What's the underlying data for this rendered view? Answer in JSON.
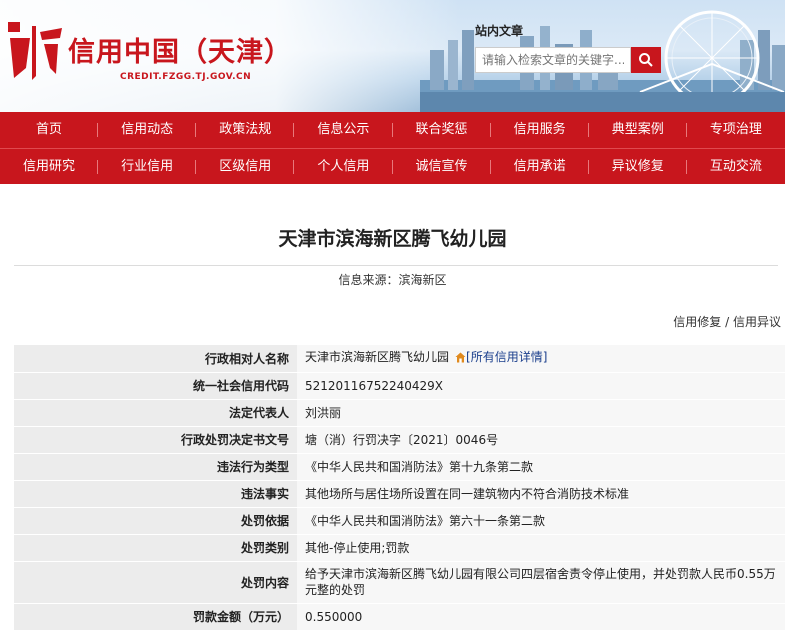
{
  "header": {
    "site_title": "信用中国（天津）",
    "site_domain": "CREDIT.FZGG.TJ.GOV.CN",
    "search_title": "站内文章",
    "search_placeholder": "请输入检索文章的关键字..."
  },
  "nav": {
    "row1": [
      "首页",
      "信用动态",
      "政策法规",
      "信息公示",
      "联合奖惩",
      "信用服务",
      "典型案例",
      "专项治理"
    ],
    "row2": [
      "信用研究",
      "行业信用",
      "区级信用",
      "个人信用",
      "诚信宣传",
      "信用承诺",
      "异议修复",
      "互动交流"
    ]
  },
  "page": {
    "title": "天津市滨海新区腾飞幼儿园",
    "source": "信息来源：滨海新区",
    "link_repair": "信用修复",
    "link_sep": " / ",
    "link_objection": "信用异议",
    "detail_link": "[所有信用详情]"
  },
  "rows": [
    {
      "label": "行政相对人名称",
      "value": "天津市滨海新区腾飞幼儿园"
    },
    {
      "label": "统一社会信用代码",
      "value": "52120116752240429X"
    },
    {
      "label": "法定代表人",
      "value": "刘洪丽"
    },
    {
      "label": "行政处罚决定书文号",
      "value": "塘（消）行罚决字〔2021〕0046号"
    },
    {
      "label": "违法行为类型",
      "value": "《中华人民共和国消防法》第十九条第二款"
    },
    {
      "label": "违法事实",
      "value": "其他场所与居住场所设置在同一建筑物内不符合消防技术标准"
    },
    {
      "label": "处罚依据",
      "value": "《中华人民共和国消防法》第六十一条第二款"
    },
    {
      "label": "处罚类别",
      "value": "其他-停止使用;罚款"
    },
    {
      "label": "处罚内容",
      "value": "给予天津市滨海新区腾飞幼儿园有限公司四层宿舍责令停止使用，并处罚款人民币0.55万元整的处罚"
    },
    {
      "label": "罚款金额（万元）",
      "value": "0.550000"
    }
  ],
  "colors": {
    "brand_red": "#c8161d",
    "link_blue": "#1a3e8c"
  }
}
